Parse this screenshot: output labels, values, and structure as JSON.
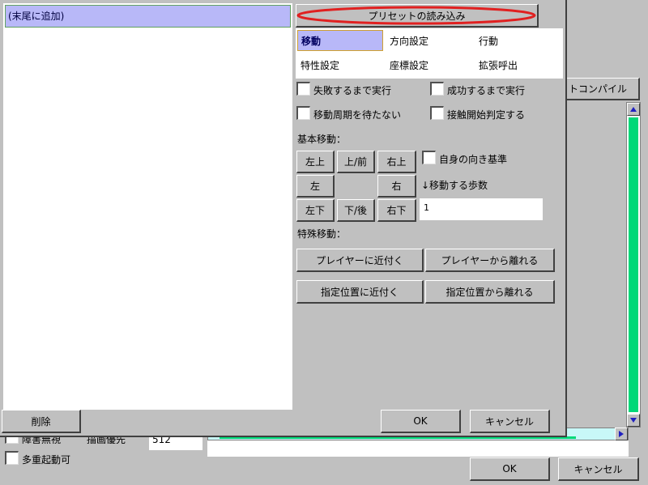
{
  "colors": {
    "dialog_bg": "#c0c0c0",
    "list_selected_bg": "#b8b8f8",
    "scroll_thumb": "#00d878",
    "hscroll_bg": "#c8f8f8",
    "preset_oval": "#e02020",
    "arrow_blue": "#2020c0"
  },
  "command_list": {
    "items": [
      "(末尾に追加)"
    ]
  },
  "preset": {
    "load_label": "プリセットの読み込み"
  },
  "tabs": [
    {
      "label": "移動"
    },
    {
      "label": "方向設定"
    },
    {
      "label": "行動"
    },
    {
      "label": "特性設定"
    },
    {
      "label": "座標設定"
    },
    {
      "label": "拡張呼出"
    }
  ],
  "options": {
    "run_until_fail": "失敗するまで実行",
    "run_until_success": "成功するまで実行",
    "no_wait_cycle": "移動周期を待たない",
    "contact_judge": "接触開始判定する"
  },
  "basic_move": {
    "heading": "基本移動：",
    "up_left": "左上",
    "up": "上/前",
    "up_right": "右上",
    "left": "左",
    "right": "右",
    "down_left": "左下",
    "down": "下/後",
    "down_right": "右下",
    "self_direction": "自身の向き基準",
    "steps_label": "↓移動する歩数",
    "steps_value": "1"
  },
  "special_move": {
    "heading": "特殊移動：",
    "approach_player": "プレイヤーに近付く",
    "away_player": "プレイヤーから離れる",
    "approach_point": "指定位置に近付く",
    "away_point": "指定位置から離れる"
  },
  "dialog": {
    "ok": "OK",
    "cancel": "キャンセル"
  },
  "left_panel": {
    "delete": "削除"
  },
  "background": {
    "compile_button": "トコンパイル",
    "ignore_obstacle": "障害無視",
    "draw_priority_label": "描画優先",
    "draw_priority_value": "512",
    "multi_start": "多重起動可",
    "ok": "OK",
    "cancel": "キャンセル"
  }
}
